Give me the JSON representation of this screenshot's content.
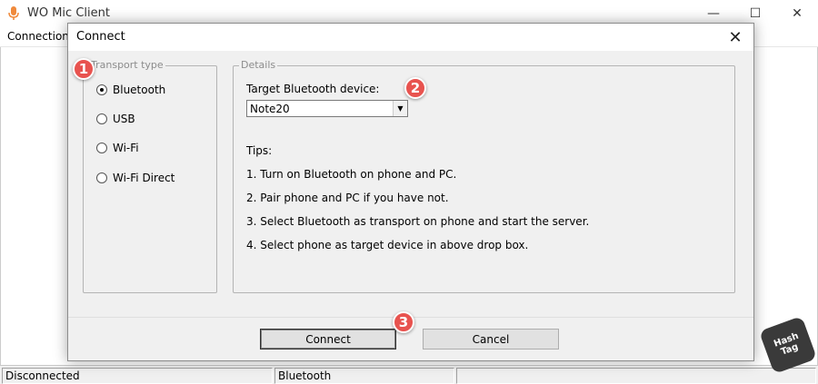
{
  "main_window": {
    "title": "WO Mic Client",
    "menu": {
      "connection": "Connection"
    },
    "controls": {
      "minimize": "—",
      "maximize": "☐",
      "close": "✕"
    }
  },
  "dialog": {
    "title": "Connect",
    "close_glyph": "✕",
    "transport": {
      "legend": "Transport type",
      "options": [
        {
          "label": "Bluetooth",
          "checked": true
        },
        {
          "label": "USB",
          "checked": false
        },
        {
          "label": "Wi-Fi",
          "checked": false
        },
        {
          "label": "Wi-Fi Direct",
          "checked": false
        }
      ]
    },
    "details": {
      "legend": "Details",
      "device_label": "Target Bluetooth device:",
      "device_value": "Note20",
      "dropdown_arrow": "▼",
      "tips_heading": "Tips:",
      "tips": [
        "1. Turn on Bluetooth on phone and PC.",
        "2. Pair phone and PC if you have not.",
        "3. Select Bluetooth as transport on phone and start the server.",
        "4. Select phone as target device in above drop box."
      ]
    },
    "buttons": {
      "connect": "Connect",
      "cancel": "Cancel"
    }
  },
  "statusbar": {
    "status": "Disconnected",
    "transport": "Bluetooth"
  },
  "annotations": {
    "step1": "1",
    "step2": "2",
    "step3": "3"
  },
  "watermark": {
    "line1": "Hash",
    "line2": "Tag"
  },
  "colors": {
    "badge": "#e8534f",
    "dialog_bg": "#f0f0f0",
    "app_icon": "#f08a3c"
  }
}
